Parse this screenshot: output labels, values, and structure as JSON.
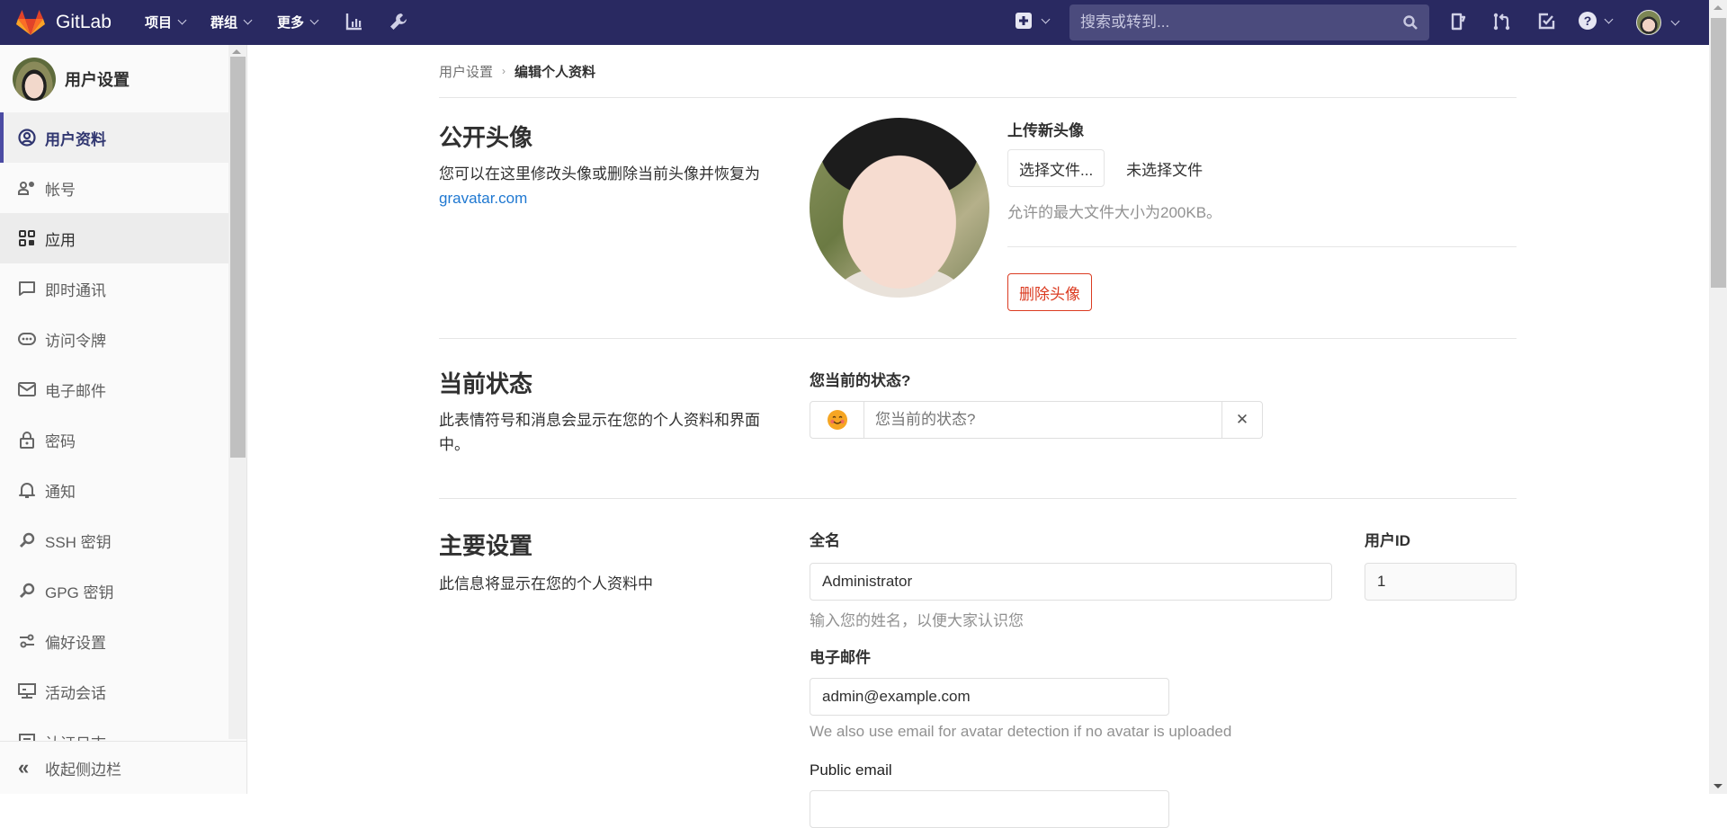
{
  "navbar": {
    "brand": "GitLab",
    "menus": [
      {
        "label": "项目"
      },
      {
        "label": "群组"
      },
      {
        "label": "更多"
      }
    ],
    "icons": [
      "activity-chart-icon",
      "admin-wrench-icon"
    ],
    "new_menu_icon": "plus-square-icon",
    "search_placeholder": "搜索或转到...",
    "right_icons": [
      "issues-icon",
      "merge-requests-icon",
      "todos-icon",
      "help-icon",
      "user-avatar"
    ],
    "colors": {
      "background": "#292961",
      "search_bg": "#4b4b7d"
    }
  },
  "sidebar": {
    "title": "用户设置",
    "items": [
      {
        "label": "用户资料",
        "icon": "profile-icon",
        "state": "active"
      },
      {
        "label": "帐号",
        "icon": "account-icon",
        "state": ""
      },
      {
        "label": "应用",
        "icon": "applications-icon",
        "state": "hover"
      },
      {
        "label": "即时通讯",
        "icon": "chat-icon",
        "state": ""
      },
      {
        "label": "访问令牌",
        "icon": "token-icon",
        "state": ""
      },
      {
        "label": "电子邮件",
        "icon": "email-icon",
        "state": ""
      },
      {
        "label": "密码",
        "icon": "lock-icon",
        "state": ""
      },
      {
        "label": "通知",
        "icon": "bell-icon",
        "state": ""
      },
      {
        "label": "SSH 密钥",
        "icon": "key-icon",
        "state": ""
      },
      {
        "label": "GPG 密钥",
        "icon": "key-icon",
        "state": ""
      },
      {
        "label": "偏好设置",
        "icon": "preferences-icon",
        "state": ""
      },
      {
        "label": "活动会话",
        "icon": "sessions-icon",
        "state": ""
      },
      {
        "label": "认证日志",
        "icon": "log-icon",
        "state": ""
      }
    ],
    "collapse_label": "收起侧边栏"
  },
  "breadcrumb": {
    "parent": "用户设置",
    "current": "编辑个人资料"
  },
  "avatar_section": {
    "title": "公开头像",
    "description": "您可以在这里修改头像或删除当前头像并恢复为",
    "link": "gravatar.com",
    "upload_label": "上传新头像",
    "choose_file_button": "选择文件...",
    "no_file_text": "未选择文件",
    "max_size_help": "允许的最大文件大小为200KB。",
    "remove_button": "删除头像"
  },
  "status_section": {
    "title": "当前状态",
    "description": "此表情符号和消息会显示在您的个人资料和界面中。",
    "field_label": "您当前的状态?",
    "placeholder": "您当前的状态?",
    "emoji": "😊",
    "clear_icon": "✕"
  },
  "main_settings": {
    "title": "主要设置",
    "description": "此信息将显示在您的个人资料中",
    "full_name_label": "全名",
    "full_name_value": "Administrator",
    "full_name_help": "输入您的姓名，以便大家认识您",
    "user_id_label": "用户ID",
    "user_id_value": "1",
    "email_label": "电子邮件",
    "email_value": "admin@example.com",
    "email_help": "We also use email for avatar detection if no avatar is uploaded",
    "public_email_label": "Public email"
  }
}
